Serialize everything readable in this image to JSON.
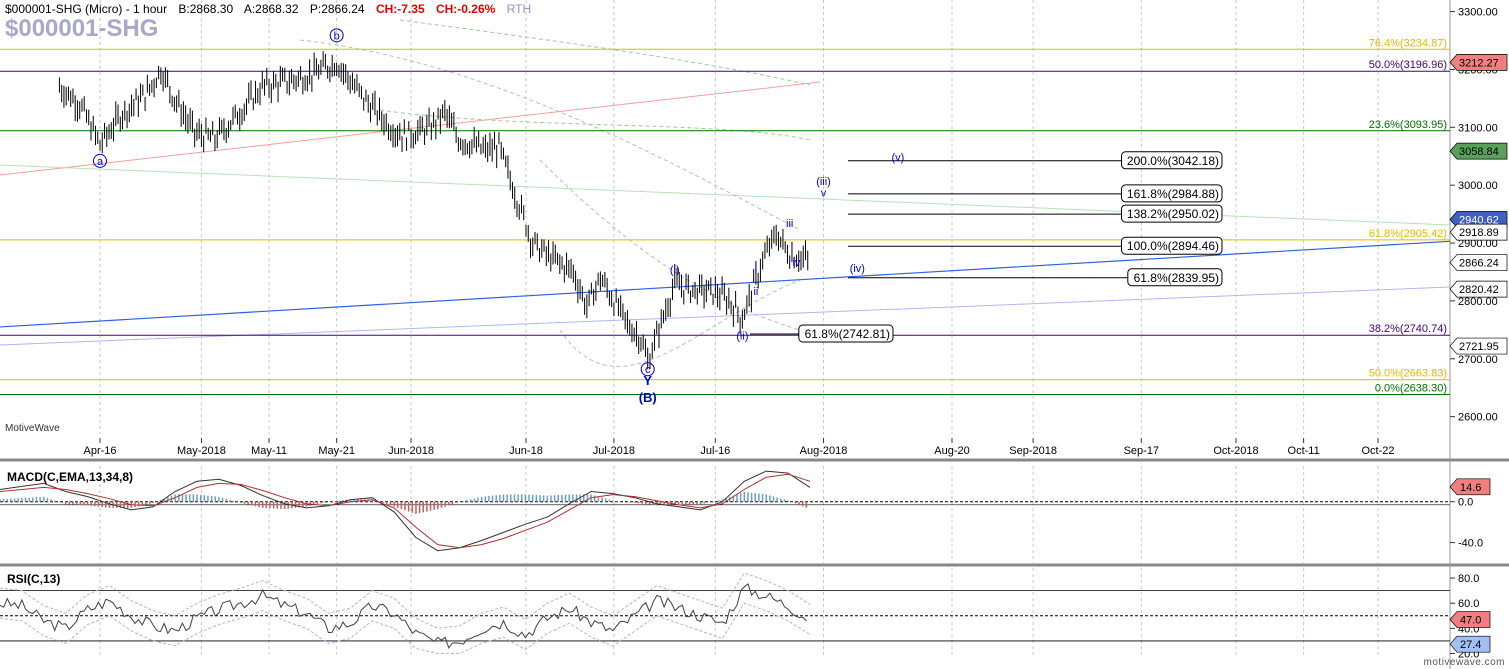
{
  "header": {
    "symbol": "$000001-SHG (Micro) - 1 hour",
    "bid": "B:2868.30",
    "ask": "A:2868.32",
    "price": "P:2866.24",
    "change": "CH:-7.35",
    "change_pct": "CH:-0.26%",
    "session": "RTH",
    "watermark": "$000001-SHG"
  },
  "brand": {
    "left": "MotiveWave",
    "bottom_right": "motivewave.com"
  },
  "colors": {
    "up": "#000000",
    "fib_gold": "#e6b800",
    "fib_purple": "#400080",
    "fib_green": "#007000",
    "trend_blue": "#3060e0",
    "wave_blue": "#0000cc",
    "last_price": "#f08080",
    "macd_hist": "#6aa0c8",
    "macd_neg": "#c06060",
    "rsi_line": "#404040"
  },
  "chart_data": [
    {
      "type": "candlestick",
      "title": "$000001-SHG (Micro) - 1 hour",
      "x_ticks": [
        "Apr-16",
        "May-2018",
        "May-11",
        "May-21",
        "Jun-2018",
        "Jun-18",
        "Jul-2018",
        "Jul-16",
        "Aug-2018",
        "Aug-20",
        "Sep-2018",
        "Sep-17",
        "Oct-2018",
        "Oct-11",
        "Oct-22"
      ],
      "y_ticks": [
        2600,
        2700,
        2800,
        2900,
        3000,
        3100,
        3200,
        3300
      ],
      "ylim": [
        2570,
        3320
      ],
      "price_path": [
        [
          "Apr-10",
          3170
        ],
        [
          "Apr-13",
          3140
        ],
        [
          "Apr-16",
          3070
        ],
        [
          "Apr-19",
          3120
        ],
        [
          "Apr-23",
          3160
        ],
        [
          "Apr-25",
          3200
        ],
        [
          "Apr-27",
          3150
        ],
        [
          "Apr-30",
          3090
        ],
        [
          "May-03",
          3080
        ],
        [
          "May-07",
          3130
        ],
        [
          "May-10",
          3170
        ],
        [
          "May-14",
          3180
        ],
        [
          "May-17",
          3190
        ],
        [
          "May-21",
          3212
        ],
        [
          "May-23",
          3180
        ],
        [
          "May-25",
          3150
        ],
        [
          "May-29",
          3100
        ],
        [
          "May-31",
          3085
        ],
        [
          "Jun-04",
          3100
        ],
        [
          "Jun-06",
          3125
        ],
        [
          "Jun-08",
          3080
        ],
        [
          "Jun-12",
          3060
        ],
        [
          "Jun-14",
          3065
        ],
        [
          "Jun-19",
          2900
        ],
        [
          "Jun-21",
          2880
        ],
        [
          "Jun-25",
          2850
        ],
        [
          "Jun-27",
          2790
        ],
        [
          "Jun-29",
          2840
        ],
        [
          "Jul-03",
          2760
        ],
        [
          "Jul-05",
          2735
        ],
        [
          "Jul-06",
          2695
        ],
        [
          "Jul-10",
          2830
        ],
        [
          "Jul-12",
          2820
        ],
        [
          "Jul-16",
          2815
        ],
        [
          "Jul-18",
          2800
        ],
        [
          "Jul-20",
          2770
        ],
        [
          "Jul-23",
          2870
        ],
        [
          "Jul-25",
          2915
        ],
        [
          "Jul-27",
          2880
        ],
        [
          "Jul-30",
          2870
        ]
      ],
      "fib_levels": [
        {
          "label": "76.4%(3234.87)",
          "value": 3234.87,
          "color": "#e6b800"
        },
        {
          "label": "50.0%(3196.96)",
          "value": 3196.96,
          "color": "#400080"
        },
        {
          "label": "23.6%(3093.95)",
          "value": 3093.95,
          "color": "#007000"
        },
        {
          "label": "61.8%(2905.42)",
          "value": 2905.42,
          "color": "#e6b800"
        },
        {
          "label": "38.2%(2740.74)",
          "value": 2740.74,
          "color": "#400080"
        },
        {
          "label": "50.0%(2663.83)",
          "value": 2663.83,
          "color": "#e6b800"
        },
        {
          "label": "0.0%(2638.30)",
          "value": 2638.3,
          "color": "#007000"
        }
      ],
      "projections": [
        {
          "label": "200.0%(3042.18)",
          "value": 3042.18
        },
        {
          "label": "161.8%(2984.88)",
          "value": 2984.88
        },
        {
          "label": "138.2%(2950.02)",
          "value": 2950.02
        },
        {
          "label": "100.0%(2894.46)",
          "value": 2894.46
        },
        {
          "label": "61.8%(2839.95)",
          "value": 2839.95
        },
        {
          "label": "61.8%(2742.81)",
          "value": 2742.81
        }
      ],
      "price_tags": [
        {
          "label": "3212.27",
          "value": 3212.27,
          "style": "red"
        },
        {
          "label": "3058.84",
          "value": 3058.84,
          "style": "green"
        },
        {
          "label": "2940.62",
          "value": 2940.62,
          "style": "blue"
        },
        {
          "label": "2918.89",
          "value": 2918.89,
          "style": "white"
        },
        {
          "label": "2866.24",
          "value": 2866.24,
          "style": "white"
        },
        {
          "label": "2820.42",
          "value": 2820.42,
          "style": "white"
        },
        {
          "label": "2721.95",
          "value": 2721.95,
          "style": "white"
        }
      ],
      "wave_labels": [
        {
          "text": "b",
          "circled": true,
          "date": "May-21",
          "value": 3252
        },
        {
          "text": "a",
          "circled": true,
          "date": "Apr-16",
          "value": 3035
        },
        {
          "text": "c",
          "circled": true,
          "date": "Jul-06",
          "value": 2675
        },
        {
          "text": "Y",
          "date": "Jul-06",
          "value": 2655
        },
        {
          "text": "(B)",
          "date": "Jul-06",
          "value": 2625
        },
        {
          "text": "(i)",
          "date": "Jul-10",
          "value": 2847
        },
        {
          "text": "(ii)",
          "date": "Jul-20",
          "value": 2733
        },
        {
          "text": "(iii)",
          "date": "Aug-01",
          "value": 3000
        },
        {
          "text": "v",
          "date": "Aug-01",
          "value": 2980
        },
        {
          "text": "(iv)",
          "date": "Aug-06",
          "value": 2850
        },
        {
          "text": "(v)",
          "date": "Aug-12",
          "value": 3042
        },
        {
          "text": "iii",
          "date": "Jul-27",
          "value": 2928
        },
        {
          "text": "iv",
          "date": "Jul-28",
          "value": 2860
        },
        {
          "text": "i",
          "date": "Jul-22",
          "value": 2848
        },
        {
          "text": "ii",
          "date": "Jul-22",
          "value": 2810
        }
      ]
    },
    {
      "type": "line",
      "title": "MACD(C,EMA,13,34,8)",
      "y_ticks": [
        0.0,
        -40.0
      ],
      "ylim": [
        -60,
        35
      ],
      "last_value_label": "14.6",
      "macd": [
        12,
        15,
        18,
        10,
        5,
        -2,
        -8,
        -5,
        10,
        20,
        22,
        16,
        6,
        -2,
        -6,
        -4,
        2,
        4,
        -10,
        -35,
        -48,
        -45,
        -38,
        -30,
        -22,
        -15,
        -2,
        10,
        8,
        4,
        -2,
        -5,
        -8,
        0,
        20,
        30,
        28,
        14
      ],
      "signal": [
        10,
        12,
        14,
        12,
        8,
        3,
        -3,
        -4,
        4,
        14,
        18,
        17,
        11,
        4,
        -2,
        -4,
        0,
        2,
        -6,
        -25,
        -42,
        -45,
        -42,
        -36,
        -28,
        -20,
        -8,
        4,
        7,
        5,
        1,
        -3,
        -6,
        -2,
        12,
        24,
        27,
        20
      ]
    },
    {
      "type": "line",
      "title": "RSI(C,13)",
      "y_ticks": [
        20.0,
        40.0,
        60.0,
        80.0
      ],
      "ylim": [
        18,
        88
      ],
      "levels": [
        70,
        30
      ],
      "last_value_labels": [
        "47.0",
        "27.4"
      ],
      "values": [
        60,
        58,
        46,
        40,
        55,
        62,
        50,
        42,
        38,
        48,
        55,
        60,
        66,
        58,
        52,
        40,
        44,
        58,
        52,
        36,
        28,
        30,
        40,
        45,
        35,
        48,
        56,
        45,
        38,
        50,
        62,
        56,
        50,
        44,
        72,
        66,
        58,
        47
      ]
    }
  ]
}
